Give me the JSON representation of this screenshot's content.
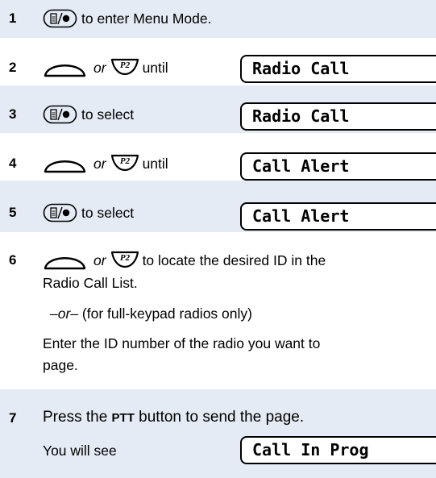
{
  "steps": [
    {
      "num": "1",
      "text": "to enter Menu Mode."
    },
    {
      "num": "2",
      "or": "or",
      "text": "until",
      "display": "Radio Call"
    },
    {
      "num": "3",
      "text": "to select",
      "display": "Radio Call"
    },
    {
      "num": "4",
      "or": "or",
      "text": "until",
      "display": "Call Alert"
    },
    {
      "num": "5",
      "text": "to select",
      "display": "Call Alert"
    },
    {
      "num": "6",
      "or": "or",
      "text": "to locate the desired ID in the",
      "text2": "Radio Call List.",
      "alt_dash": "–or–",
      "alt_note": "(for full-keypad radios only)",
      "alt_text1": "Enter the ID number of the radio you want to",
      "alt_text2": "page."
    },
    {
      "num": "7",
      "pre": "Press the",
      "button": "PTT",
      "post": "button to send the page.",
      "see": "You will see",
      "display": "Call In Prog"
    }
  ],
  "icons": {
    "menu": "menu-select-button-icon",
    "nav": "navigation-dome-button-icon",
    "p2": "p2-button-icon"
  },
  "colors": {
    "shade": "#e4ebf4"
  }
}
